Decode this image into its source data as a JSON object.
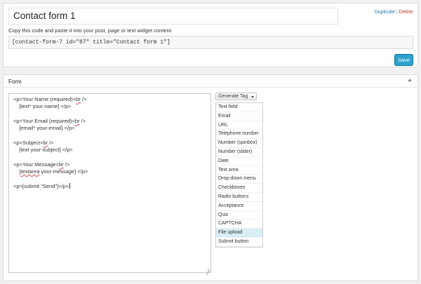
{
  "top": {
    "form_title": "Contact form 1",
    "actions": {
      "duplicate": "Duplicate",
      "separator": "|",
      "delete": "Delete"
    },
    "instruction": "Copy this code and paste it into your post, page or text widget content.",
    "shortcode": "[contact-form-7 id=\"87\" title=\"Contact form 1\"]",
    "save_label": "Save"
  },
  "form_panel": {
    "header": "Form",
    "editor": {
      "l1a": "<p>Your Name (required)<",
      "l1b": "br",
      "l1c": " />",
      "l2": "    [text* your-name] </p>",
      "l3a": "<p>Your Email (required)<",
      "l3b": "br",
      "l3c": " />",
      "l4": "    [email* your-email] </p>",
      "l5a": "<p>Subject<",
      "l5b": "br",
      "l5c": " />",
      "l6": "    [text your-subject] </p>",
      "l7a": "<p>Your Message<",
      "l7b": "br",
      "l7c": " />",
      "l8a": "    [",
      "l8b": "textarea",
      "l8c": " your-message] </p>",
      "l9": "<p>[submit \"Send\"]</p>"
    },
    "generate_tag_label": "Generate Tag",
    "dropdown_items": [
      "Text field",
      "Email",
      "URL",
      "Telephone number",
      "Number (spinbox)",
      "Number (slider)",
      "Date",
      "Text area",
      "Drop-down menu",
      "Checkboxes",
      "Radio buttons",
      "Acceptance",
      "Quiz",
      "CAPTCHA",
      "File upload",
      "Submit button"
    ],
    "highlighted_item": "File upload"
  },
  "colors": {
    "accent": "#2ea2cc",
    "link": "#2a7ab0",
    "delete": "#c0392b",
    "highlight": "#d7eef5"
  }
}
